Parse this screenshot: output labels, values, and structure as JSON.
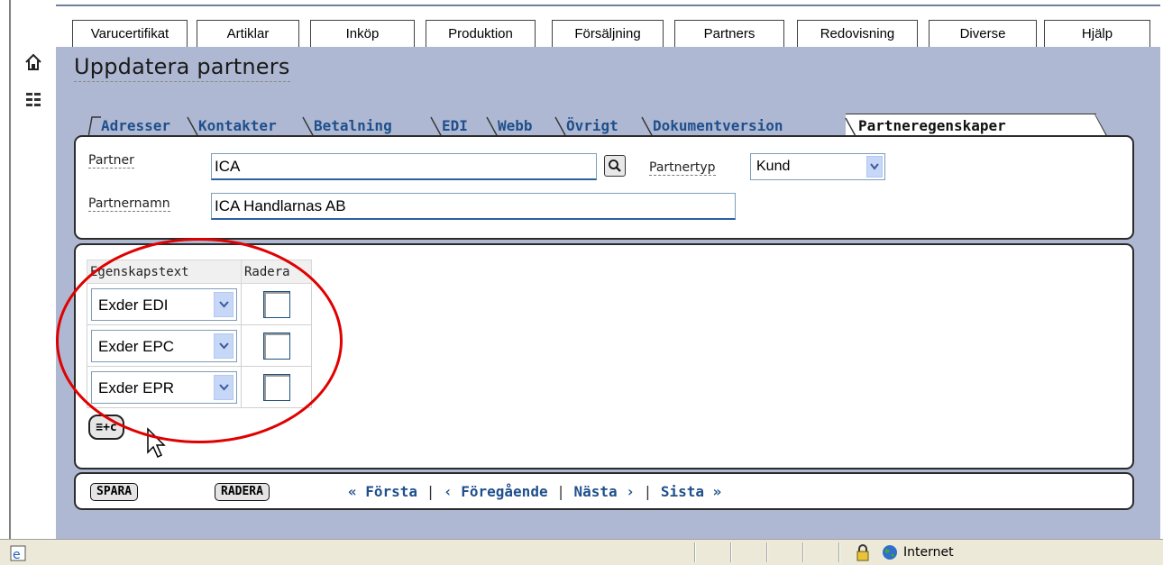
{
  "menu": [
    "Varucertifikat",
    "Artiklar",
    "Inköp",
    "Produktion",
    "Försäljning",
    "Partners",
    "Redovisning",
    "Diverse",
    "Hjälp"
  ],
  "page_title": "Uppdatera partners",
  "tabs": [
    "Adresser",
    "Kontakter",
    "Betalning",
    "EDI",
    "Webb",
    "Övrigt",
    "Dokumentversion",
    "Partneregenskaper"
  ],
  "active_tab": "Partneregenskaper",
  "partner": {
    "partner_label": "Partner",
    "partner_value": "ICA",
    "partnertyp_label": "Partnertyp",
    "partnertyp_value": "Kund",
    "partnernamn_label": "Partnernamn",
    "partnernamn_value": "ICA Handlarnas AB"
  },
  "properties": {
    "col_text": "Egenskapstext",
    "col_delete": "Radera",
    "rows": [
      {
        "value": "Exder EDI",
        "delete": false
      },
      {
        "value": "Exder EPC",
        "delete": false
      },
      {
        "value": "Exder EPR",
        "delete": false
      }
    ],
    "add_button": "≡+c"
  },
  "actions": {
    "save": "SPARA",
    "delete": "RADERA",
    "first": "« Första",
    "prev": "‹ Föregående",
    "next": "Nästa ›",
    "last": "Sista »",
    "sep": "|"
  },
  "statusbar": {
    "zone": "Internet"
  },
  "colors": {
    "link": "#1f4f8c",
    "main_bg": "#aeb8d2",
    "annotation": "#e00000"
  }
}
